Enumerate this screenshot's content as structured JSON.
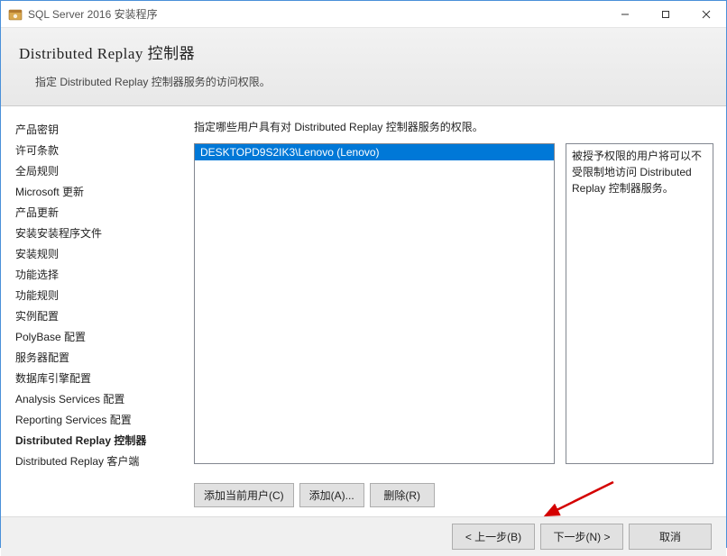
{
  "window": {
    "title": "SQL Server 2016 安装程序"
  },
  "header": {
    "title": "Distributed  Replay 控制器",
    "description": "指定 Distributed Replay 控制器服务的访问权限。"
  },
  "sidebar": {
    "items": [
      {
        "label": "产品密钥",
        "active": false
      },
      {
        "label": "许可条款",
        "active": false
      },
      {
        "label": "全局规则",
        "active": false
      },
      {
        "label": "Microsoft 更新",
        "active": false
      },
      {
        "label": "产品更新",
        "active": false
      },
      {
        "label": "安装安装程序文件",
        "active": false
      },
      {
        "label": "安装规则",
        "active": false
      },
      {
        "label": "功能选择",
        "active": false
      },
      {
        "label": "功能规则",
        "active": false
      },
      {
        "label": "实例配置",
        "active": false
      },
      {
        "label": "PolyBase 配置",
        "active": false
      },
      {
        "label": "服务器配置",
        "active": false
      },
      {
        "label": "数据库引擎配置",
        "active": false
      },
      {
        "label": "Analysis Services 配置",
        "active": false
      },
      {
        "label": "Reporting Services 配置",
        "active": false
      },
      {
        "label": "Distributed Replay 控制器",
        "active": true
      },
      {
        "label": "Distributed Replay 客户端",
        "active": false
      }
    ]
  },
  "main": {
    "instruction": "指定哪些用户具有对 Distributed Replay 控制器服务的权限。",
    "users": [
      "DESKTOPD9S2IK3\\Lenovo (Lenovo)"
    ],
    "info_text": "被授予权限的用户将可以不受限制地访问 Distributed Replay 控制器服务。",
    "buttons": {
      "add_current": "添加当前用户(C)",
      "add": "添加(A)...",
      "remove": "删除(R)"
    }
  },
  "footer": {
    "back": "< 上一步(B)",
    "next": "下一步(N) >",
    "cancel": "取消"
  }
}
